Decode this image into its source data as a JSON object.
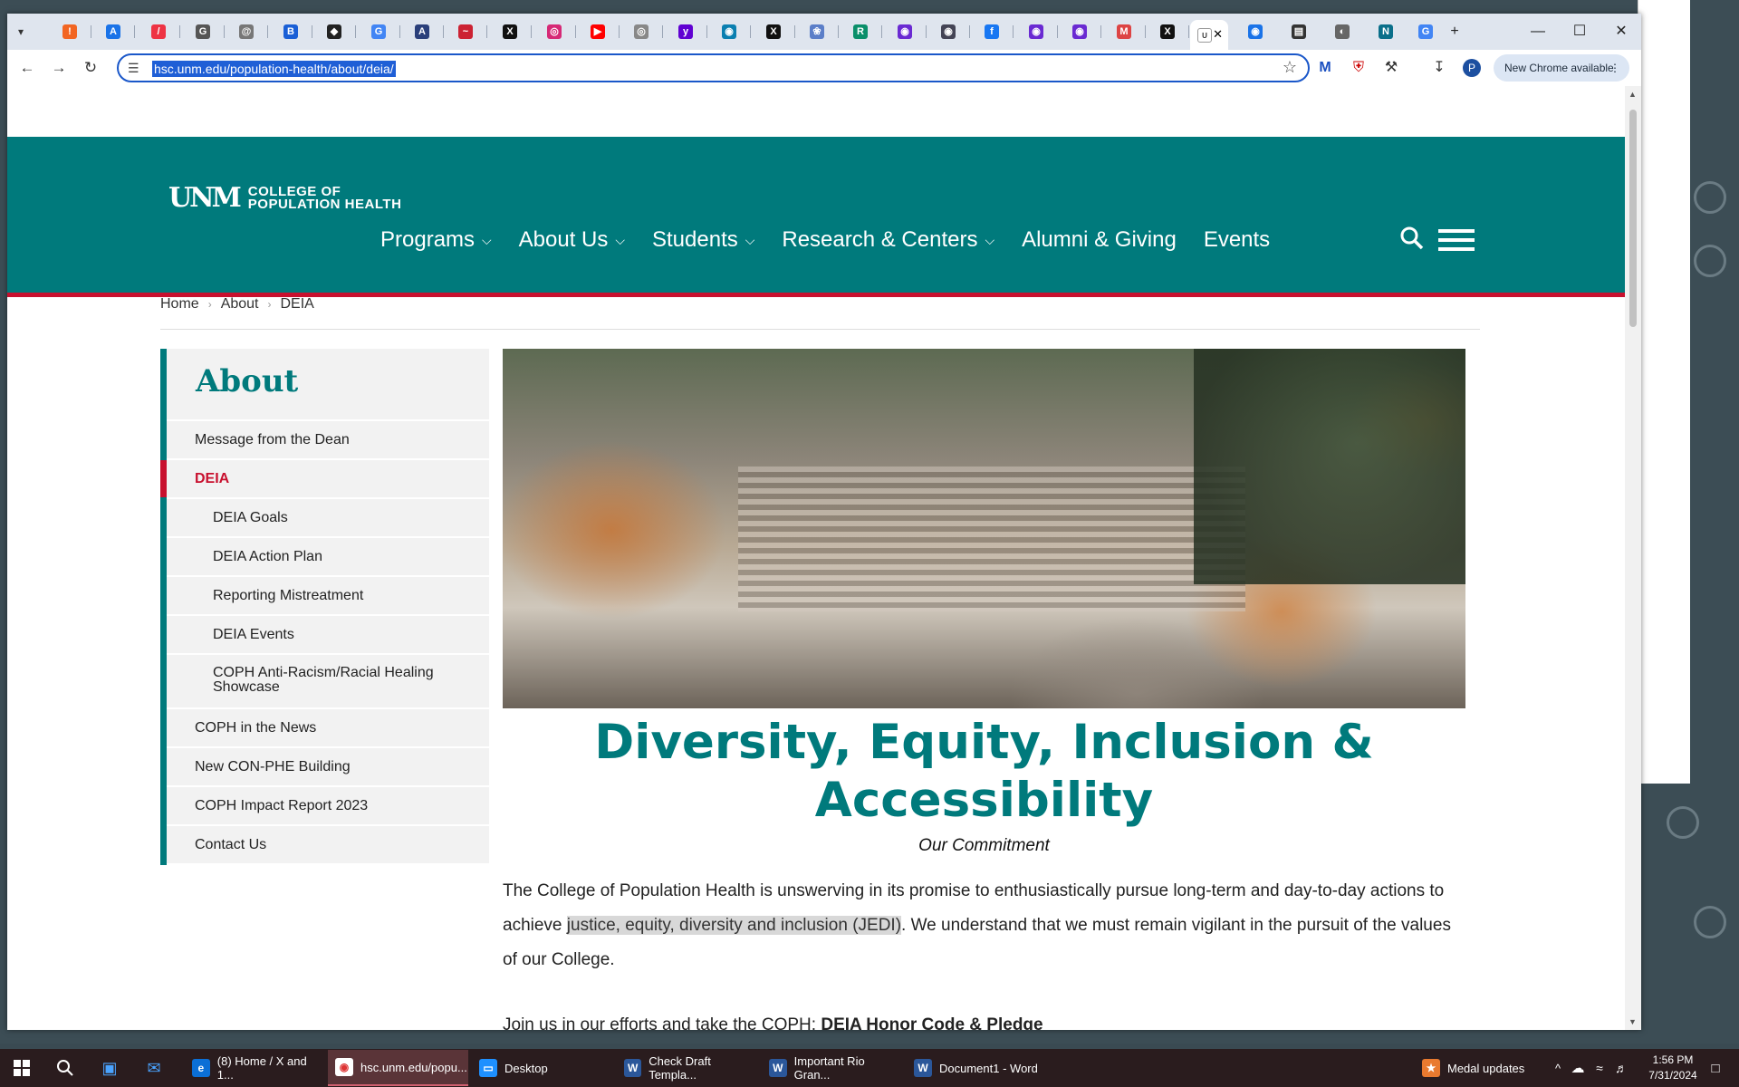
{
  "browser": {
    "url": "hsc.unm.edu/population-health/about/deia/",
    "update_label": "New Chrome available",
    "profile_initial": "P",
    "tabs_count_hint": 31
  },
  "site": {
    "logo_line1": "COLLEGE OF",
    "logo_line2": "POPULATION HEALTH",
    "logo_mark": "UNM",
    "nav": [
      {
        "label": "Programs",
        "has_menu": true
      },
      {
        "label": "About Us",
        "has_menu": true
      },
      {
        "label": "Students",
        "has_menu": true
      },
      {
        "label": "Research & Centers",
        "has_menu": true
      },
      {
        "label": "Alumni & Giving",
        "has_menu": false
      },
      {
        "label": "Events",
        "has_menu": false
      }
    ],
    "colors": {
      "teal": "#007a7c",
      "red": "#c8102e"
    }
  },
  "breadcrumb": [
    "Home",
    "About",
    "DEIA"
  ],
  "sidebar": {
    "title": "About",
    "items": [
      {
        "label": "Message from the Dean"
      },
      {
        "label": "DEIA",
        "active": true
      },
      {
        "label": "DEIA Goals",
        "sub": true
      },
      {
        "label": "DEIA Action Plan",
        "sub": true
      },
      {
        "label": "Reporting Mistreatment",
        "sub": true
      },
      {
        "label": "DEIA Events",
        "sub": true
      },
      {
        "label": "COPH Anti-Racism/Racial Healing Showcase",
        "sub": true
      },
      {
        "label": "COPH in the News"
      },
      {
        "label": "New CON-PHE Building"
      },
      {
        "label": "COPH Impact Report 2023"
      },
      {
        "label": "Contact Us"
      }
    ]
  },
  "content": {
    "title_line1": "Diversity, Equity, Inclusion &",
    "title_line2": "Accessibility",
    "subtitle": "Our Commitment",
    "para1_before": "The College of Population Health is unswerving in its promise to enthusiastically pursue long-term and day-to-day actions to achieve ",
    "para1_highlight": "justice, equity, diversity and inclusion (JEDI)",
    "para1_after": ". We understand that we must remain vigilant in the pursuit of the values of our College.",
    "para2_before": "Join us in our efforts and take the COPH: ",
    "para2_bold": "DEIA Honor Code & Pledge"
  },
  "taskbar": {
    "apps": [
      {
        "label": "(8) Home / X and 1..."
      },
      {
        "label": "hsc.unm.edu/popu...",
        "active": true
      },
      {
        "label": "Desktop"
      },
      {
        "label": "Check Draft Templa..."
      },
      {
        "label": "Important Rio Gran..."
      },
      {
        "label": "Document1 - Word"
      }
    ],
    "notification": "Medal updates",
    "time": "1:56 PM",
    "date": "7/31/2024"
  }
}
